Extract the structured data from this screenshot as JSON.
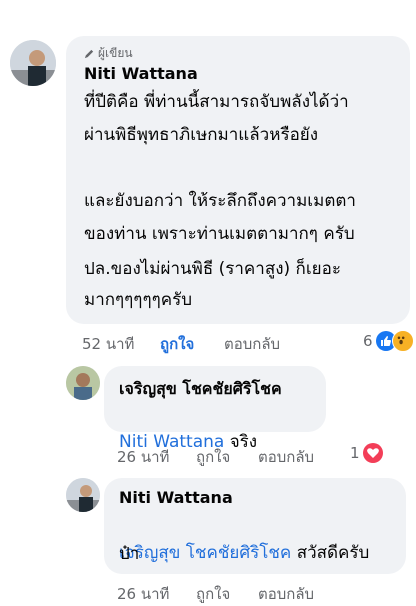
{
  "comment_main": {
    "badge": "ผู้เขียน",
    "author": "Niti Wattana",
    "lines": [
      "ที่ปีติคือ พี่ท่านนี้สามารถจับพลังได้ว่า",
      "ผ่านพิธีพุทธาภิเษกมาแล้วหรือยัง",
      "",
      "และยังบอกว่า ให้ระลึกถึงความเมตตา",
      "ของท่าน เพราะท่านเมตตามากๆ ครับ",
      "",
      "ปล.ของไม่ผ่านพิธี (ราคาสูง) ก็เยอะ",
      "มากๆๆๆๆๆครับ"
    ],
    "time": "52 นาที",
    "like_label": "ถูกใจ",
    "reply_label": "ตอบกลับ",
    "reaction_count": "6",
    "reaction_icons": [
      "like-icon",
      "wow-icon"
    ],
    "colors": {
      "like": "#1877f2",
      "wow": "#f7b125"
    }
  },
  "reply_1": {
    "author": "เจริญสุข โชคชัยศิริโชค",
    "mention": "Niti Wattana",
    "text": " จริง",
    "time": "26 นาที",
    "like_label": "ถูกใจ",
    "reply_label": "ตอบกลับ",
    "reaction_count": "1",
    "reaction_icons": [
      "love-icon"
    ],
    "colors": {
      "love": "#f33e58"
    }
  },
  "reply_2": {
    "author": "Niti Wattana",
    "mention": "เจริญสุข โชคชัยศิริโชค",
    "text_after_mention": " สวัสดีครับ",
    "second_line": "ป๋า",
    "time": "26 นาที",
    "like_label": "ถูกใจ",
    "reply_label": "ตอบกลับ"
  },
  "accent_color": "#216fdb"
}
